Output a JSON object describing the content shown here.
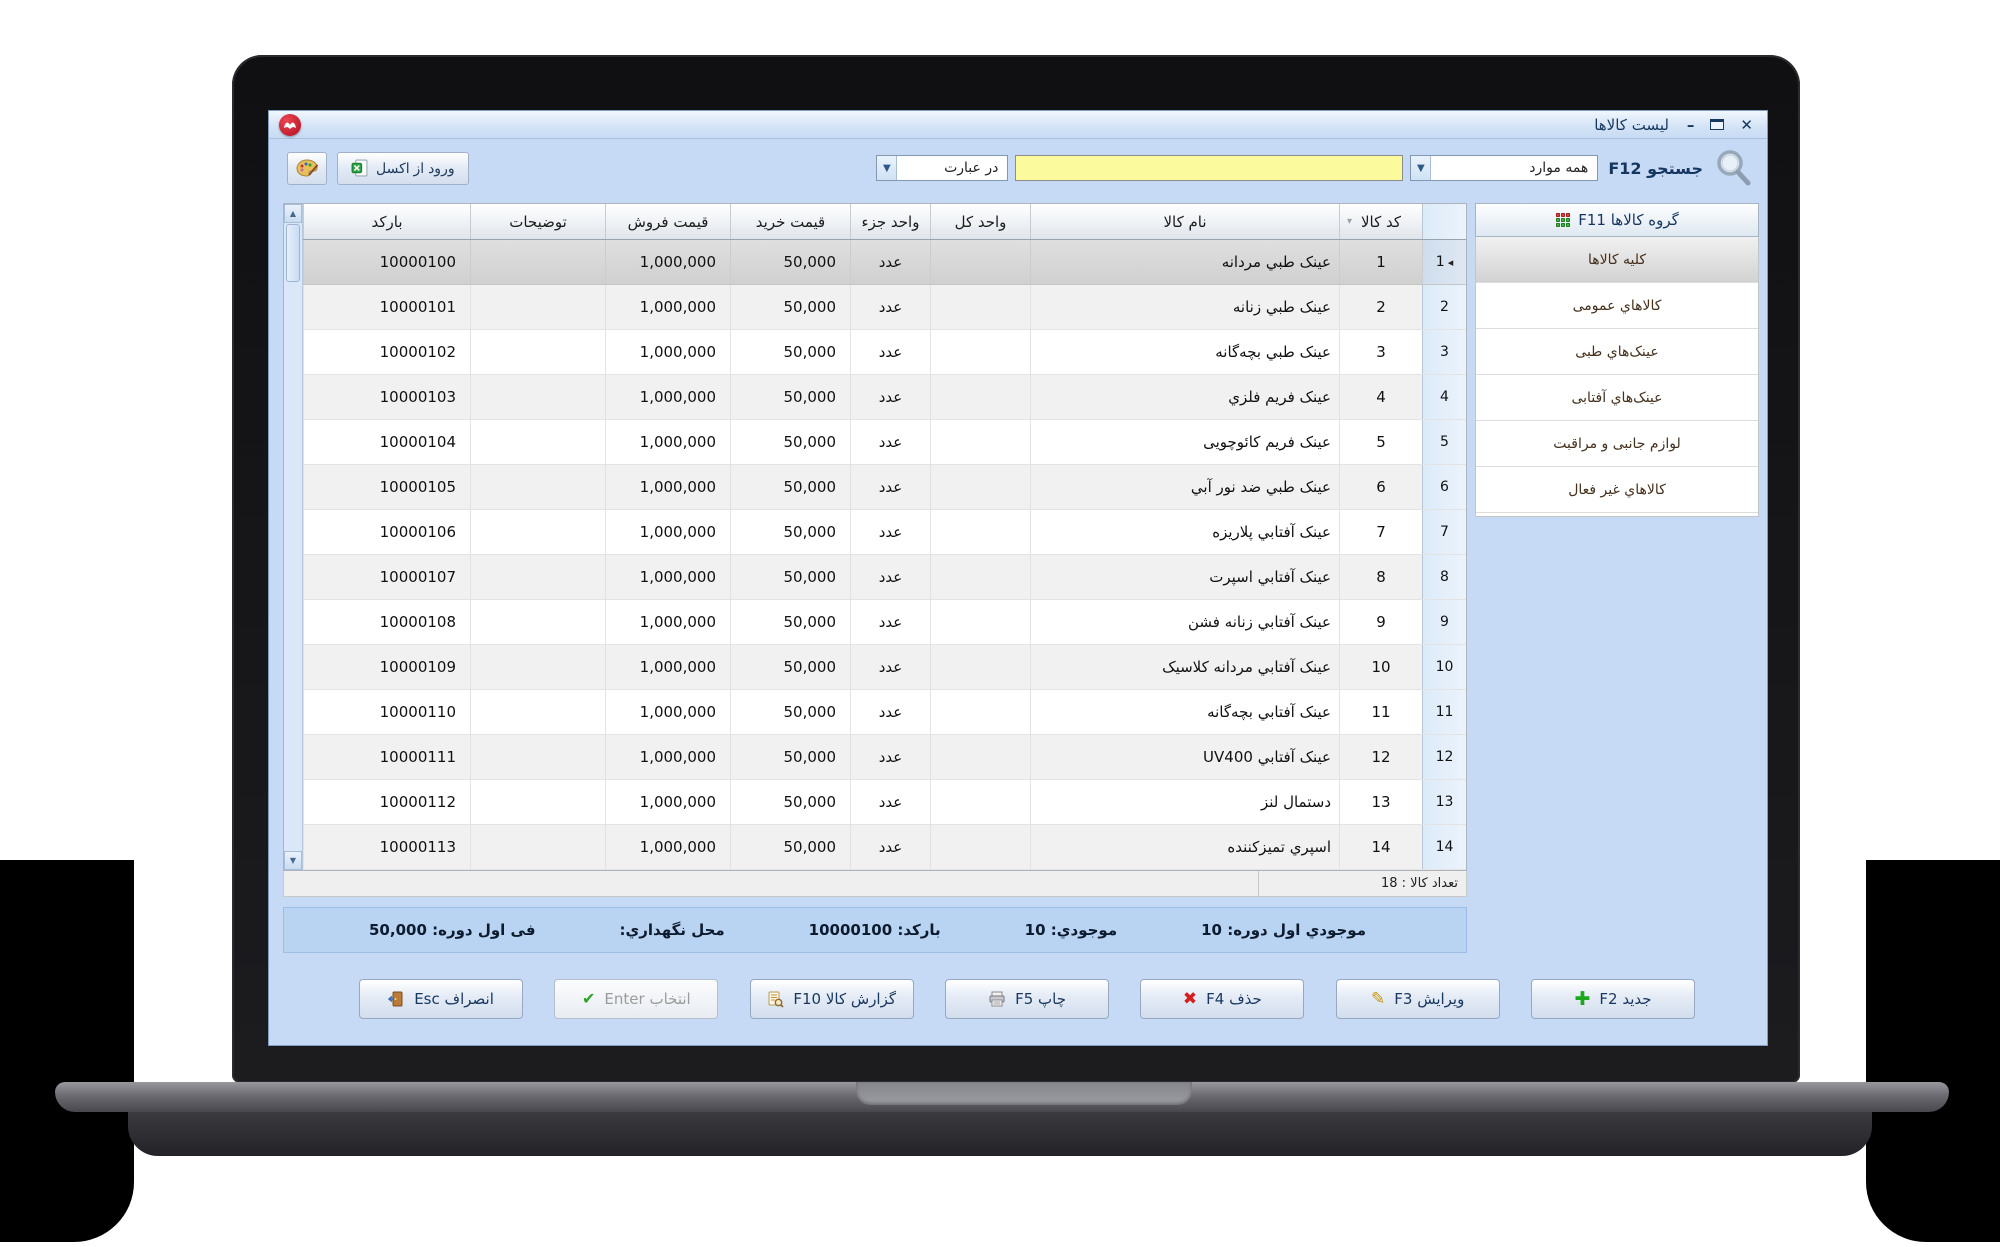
{
  "app": {
    "title": "لیست کالاها",
    "controls": {
      "minimize": "–",
      "close": "✕"
    }
  },
  "toolbar": {
    "search_label": "جستجو F12",
    "scope_value": "همه موارد",
    "search_value": "",
    "mode_value": "در عبارت",
    "excel_button": "ورود از اکسل"
  },
  "sidebar": {
    "header": "گروه کالاها F11",
    "selected_index": 0,
    "items": [
      "کلیه کالاها",
      "کالاهاي عمومی",
      "عینک‌هاي طبی",
      "عینک‌هاي آفتابی",
      "لوازم جانبی و مراقبت",
      "کالاهاي غیر فعال"
    ]
  },
  "table": {
    "headers": {
      "code": "کد کالا",
      "name": "نام کالا",
      "unit_main": "واحد کل",
      "unit_sub": "واحد جزء",
      "buy": "قیمت خرید",
      "sell": "قیمت فروش",
      "notes": "توضیحات",
      "barcode": "بارکد"
    },
    "selected_row": 1,
    "count_label": "تعداد کالا : 18",
    "rows": [
      {
        "num": 1,
        "code": "1",
        "name": "عینک طبي مردانه",
        "unit_main": "",
        "unit_sub": "عدد",
        "buy": "50,000",
        "sell": "1,000,000",
        "notes": "",
        "barcode": "10000100"
      },
      {
        "num": 2,
        "code": "2",
        "name": "عینک طبي زنانه",
        "unit_main": "",
        "unit_sub": "عدد",
        "buy": "50,000",
        "sell": "1,000,000",
        "notes": "",
        "barcode": "10000101"
      },
      {
        "num": 3,
        "code": "3",
        "name": "عینک طبي بچه‌گانه",
        "unit_main": "",
        "unit_sub": "عدد",
        "buy": "50,000",
        "sell": "1,000,000",
        "notes": "",
        "barcode": "10000102"
      },
      {
        "num": 4,
        "code": "4",
        "name": "عینک فریم فلزي",
        "unit_main": "",
        "unit_sub": "عدد",
        "buy": "50,000",
        "sell": "1,000,000",
        "notes": "",
        "barcode": "10000103"
      },
      {
        "num": 5,
        "code": "5",
        "name": "عینک فریم کائوچویی",
        "unit_main": "",
        "unit_sub": "عدد",
        "buy": "50,000",
        "sell": "1,000,000",
        "notes": "",
        "barcode": "10000104"
      },
      {
        "num": 6,
        "code": "6",
        "name": "عینک طبي ضد نور آبي",
        "unit_main": "",
        "unit_sub": "عدد",
        "buy": "50,000",
        "sell": "1,000,000",
        "notes": "",
        "barcode": "10000105"
      },
      {
        "num": 7,
        "code": "7",
        "name": "عینک آفتابي پلاریزه",
        "unit_main": "",
        "unit_sub": "عدد",
        "buy": "50,000",
        "sell": "1,000,000",
        "notes": "",
        "barcode": "10000106"
      },
      {
        "num": 8,
        "code": "8",
        "name": "عینک آفتابي اسپرت",
        "unit_main": "",
        "unit_sub": "عدد",
        "buy": "50,000",
        "sell": "1,000,000",
        "notes": "",
        "barcode": "10000107"
      },
      {
        "num": 9,
        "code": "9",
        "name": "عینک آفتابي زنانه فشن",
        "unit_main": "",
        "unit_sub": "عدد",
        "buy": "50,000",
        "sell": "1,000,000",
        "notes": "",
        "barcode": "10000108"
      },
      {
        "num": 10,
        "code": "10",
        "name": "عینک آفتابي مردانه کلاسیک",
        "unit_main": "",
        "unit_sub": "عدد",
        "buy": "50,000",
        "sell": "1,000,000",
        "notes": "",
        "barcode": "10000109"
      },
      {
        "num": 11,
        "code": "11",
        "name": "عینک آفتابي بچه‌گانه",
        "unit_main": "",
        "unit_sub": "عدد",
        "buy": "50,000",
        "sell": "1,000,000",
        "notes": "",
        "barcode": "10000110"
      },
      {
        "num": 12,
        "code": "12",
        "name": "عینک آفتابي UV400",
        "unit_main": "",
        "unit_sub": "عدد",
        "buy": "50,000",
        "sell": "1,000,000",
        "notes": "",
        "barcode": "10000111"
      },
      {
        "num": 13,
        "code": "13",
        "name": "دستمال لنز",
        "unit_main": "",
        "unit_sub": "عدد",
        "buy": "50,000",
        "sell": "1,000,000",
        "notes": "",
        "barcode": "10000112"
      },
      {
        "num": 14,
        "code": "14",
        "name": "اسپري تمیزکننده",
        "unit_main": "",
        "unit_sub": "عدد",
        "buy": "50,000",
        "sell": "1,000,000",
        "notes": "",
        "barcode": "10000113"
      }
    ]
  },
  "infobar": {
    "items": [
      "موجودي اول دوره: 10",
      "موجودي: 10",
      "بارکد: 10000100",
      "محل نگهداري:",
      "فی اول دوره: 50,000"
    ]
  },
  "actions": [
    {
      "key": "new",
      "label": "جدید F2",
      "icon": "plus-icon",
      "disabled": false
    },
    {
      "key": "edit",
      "label": "ویرایش F3",
      "icon": "pencil-icon",
      "disabled": false
    },
    {
      "key": "delete",
      "label": "حذف F4",
      "icon": "delete-icon",
      "disabled": false
    },
    {
      "key": "print",
      "label": "چاپ F5",
      "icon": "printer-icon",
      "disabled": false
    },
    {
      "key": "report",
      "label": "گزارش کالا F10",
      "icon": "report-icon",
      "disabled": false
    },
    {
      "key": "select",
      "label": "انتخاب Enter",
      "icon": "check-icon",
      "disabled": true
    },
    {
      "key": "cancel",
      "label": "انصراف Esc",
      "icon": "door-icon",
      "disabled": false
    }
  ],
  "colors": {
    "screen_bg": "#c6d9f5",
    "search_highlight": "#fbfa9d",
    "infobar_bg": "#b9d3f3",
    "title_text": "#17395f",
    "logo_red": "#c31426"
  }
}
